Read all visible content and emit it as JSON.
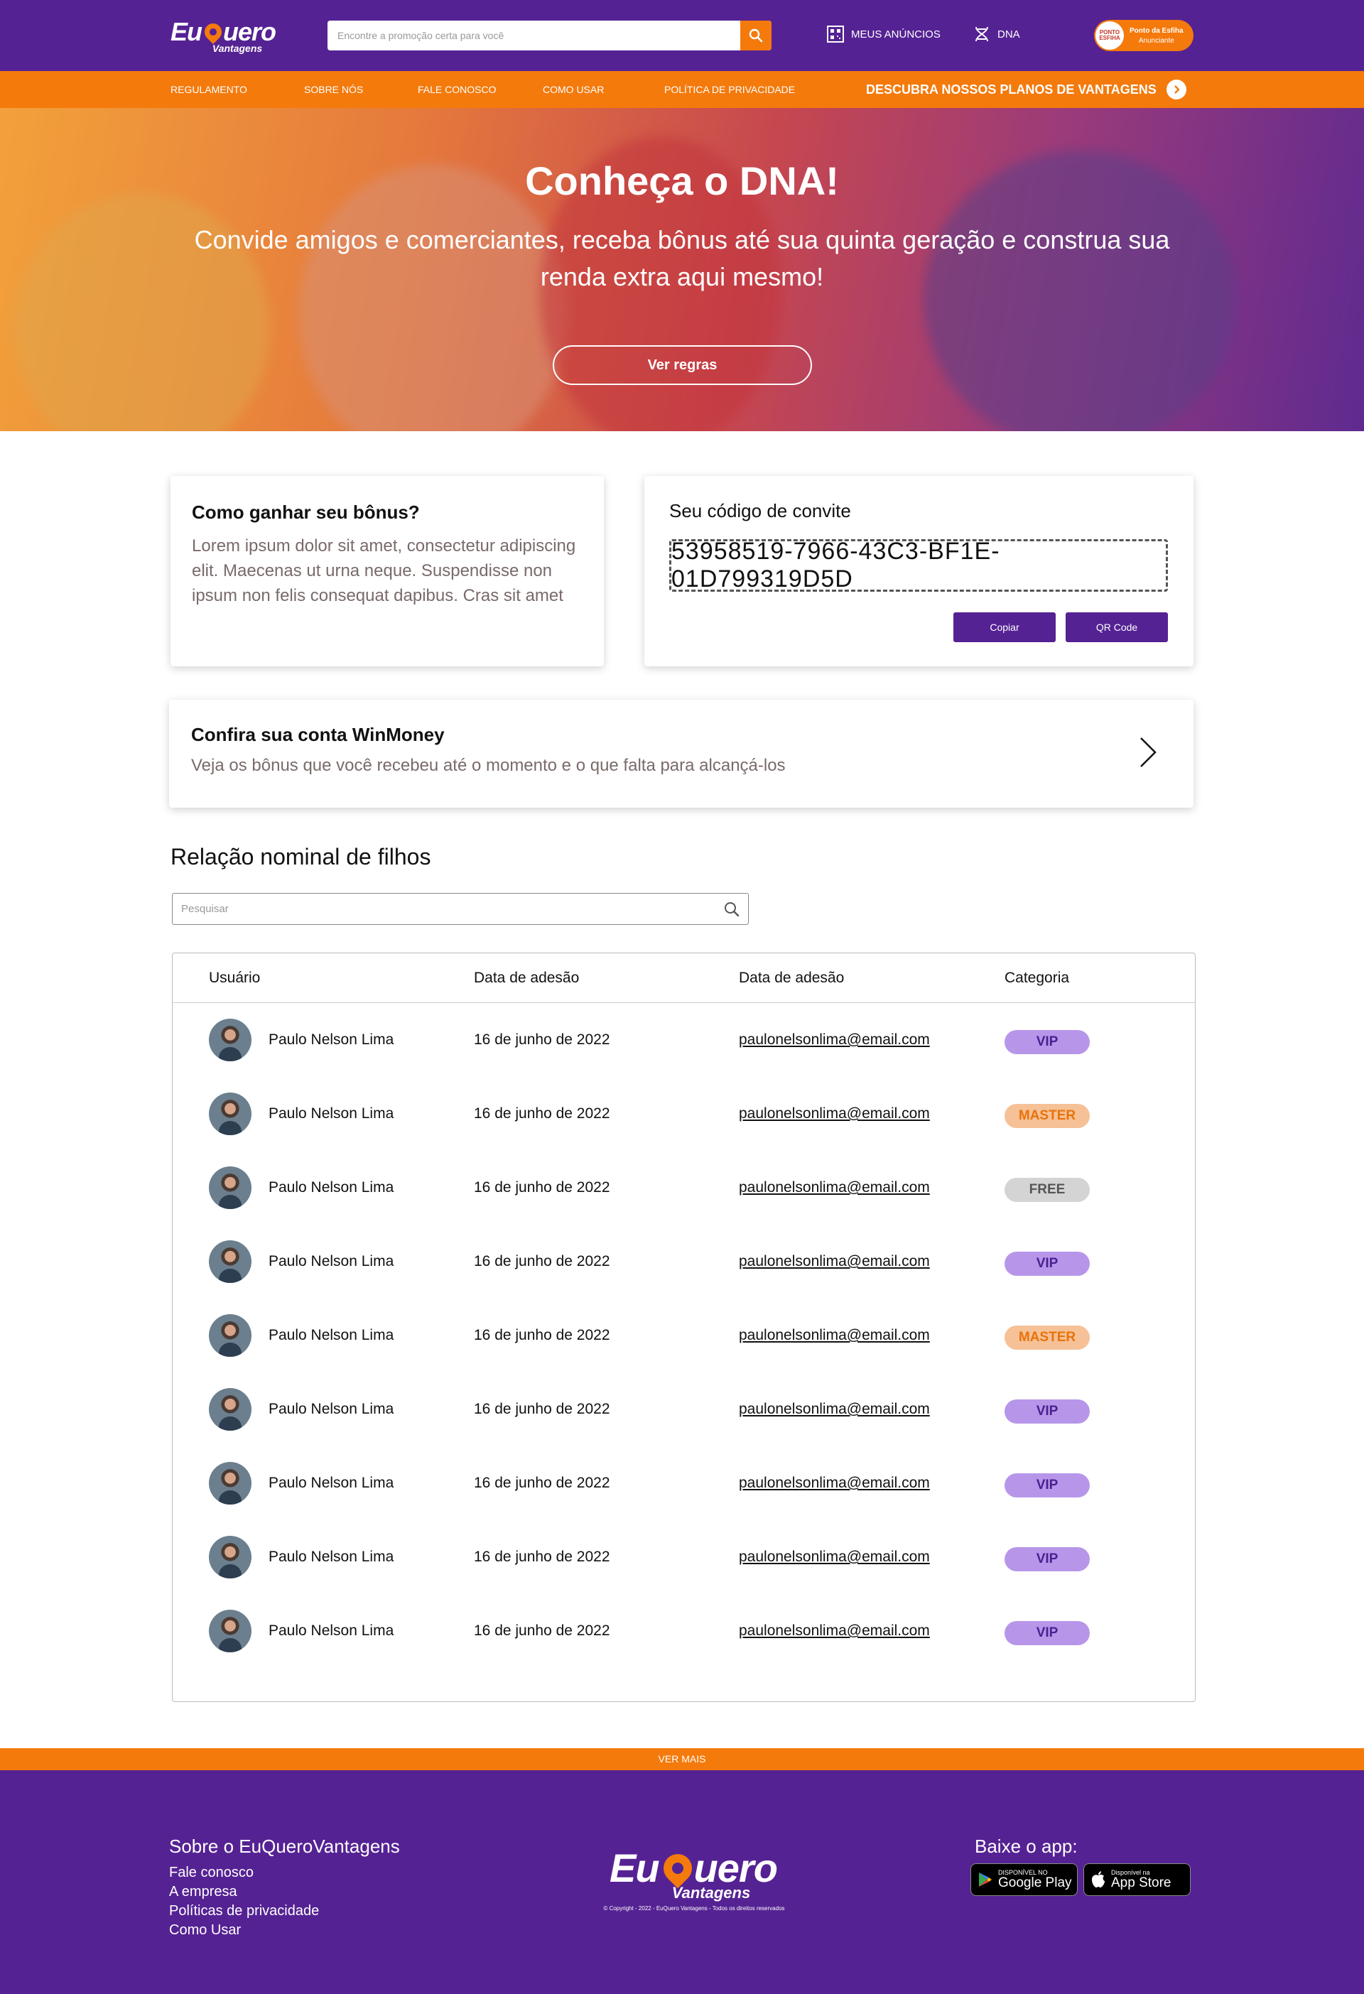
{
  "header": {
    "logo_main_left": "Eu",
    "logo_main_right": "uero",
    "logo_sub": "Vantagens",
    "search_placeholder": "Encontre a promoção certa para você",
    "meus_anuncios": "MEUS ANÚNCIOS",
    "dna": "DNA",
    "advertiser_avatar": "PONTO ESFIHA",
    "advertiser_name": "Ponto da Esfiha",
    "advertiser_role": "Anunciante"
  },
  "nav": {
    "items": [
      "REGULAMENTO",
      "SOBRE NÓS",
      "FALE CONOSCO",
      "COMO USAR",
      "POLÍTICA DE PRIVACIDADE"
    ],
    "plans": "DESCUBRA NOSSOS PLANOS DE VANTAGENS"
  },
  "hero": {
    "title": "Conheça o DNA!",
    "text": "Convide amigos e comerciantes, receba bônus até sua quinta geração e construa sua renda extra aqui mesmo!",
    "button": "Ver regras"
  },
  "bonus_card": {
    "title": "Como ganhar seu bônus?",
    "body": "Lorem ipsum dolor sit amet, consectetur adipiscing elit. Maecenas ut urna neque. Suspendisse non ipsum non felis consequat dapibus. Cras sit amet"
  },
  "invite_card": {
    "title": "Seu código de convite",
    "code": "53958519-7966-43C3-BF1E-01D799319D5D",
    "copy_button": "Copiar",
    "qr_button": "QR Code"
  },
  "winmoney_card": {
    "title": "Confira sua conta WinMoney",
    "body": "Veja os bônus que você recebeu até o momento e o que falta para alcançá-los"
  },
  "children": {
    "title": "Relação nominal de filhos",
    "search_placeholder": "Pesquisar",
    "columns": [
      "Usuário",
      "Data de adesão",
      "Data de adesão",
      "Categoria"
    ],
    "rows": [
      {
        "name": "Paulo Nelson Lima",
        "date": "16 de junho de 2022",
        "email": "paulonelsonlima@email.com",
        "category": "VIP"
      },
      {
        "name": "Paulo Nelson Lima",
        "date": "16 de junho de 2022",
        "email": "paulonelsonlima@email.com",
        "category": "MASTER"
      },
      {
        "name": "Paulo Nelson Lima",
        "date": "16 de junho de 2022",
        "email": "paulonelsonlima@email.com",
        "category": "FREE"
      },
      {
        "name": "Paulo Nelson Lima",
        "date": "16 de junho de 2022",
        "email": "paulonelsonlima@email.com",
        "category": "VIP"
      },
      {
        "name": "Paulo Nelson Lima",
        "date": "16 de junho de 2022",
        "email": "paulonelsonlima@email.com",
        "category": "MASTER"
      },
      {
        "name": "Paulo Nelson Lima",
        "date": "16 de junho de 2022",
        "email": "paulonelsonlima@email.com",
        "category": "VIP"
      },
      {
        "name": "Paulo Nelson Lima",
        "date": "16 de junho de 2022",
        "email": "paulonelsonlima@email.com",
        "category": "VIP"
      },
      {
        "name": "Paulo Nelson Lima",
        "date": "16 de junho de 2022",
        "email": "paulonelsonlima@email.com",
        "category": "VIP"
      },
      {
        "name": "Paulo Nelson Lima",
        "date": "16 de junho de 2022",
        "email": "paulonelsonlima@email.com",
        "category": "VIP"
      }
    ],
    "ver_mais": "VER MAIS"
  },
  "badge_styles": {
    "VIP": {
      "bg": "#b796ea",
      "fg": "#4b2090"
    },
    "MASTER": {
      "bg": "#f6c196",
      "fg": "#e8720c"
    },
    "FREE": {
      "bg": "#d4d4d4",
      "fg": "#555555"
    }
  },
  "footer": {
    "about_title": "Sobre o EuQueroVantagens",
    "links": [
      "Fale conosco",
      "A empresa",
      "Políticas de privacidade",
      "Como Usar"
    ],
    "copyright": "© Copyright - 2022 - EuQuero Vantagens - Todos os direitos reservados",
    "app_title": "Baixe o app:",
    "google_small": "DISPONÍVEL NO",
    "google_big": "Google Play",
    "apple_small": "Disponível na",
    "apple_big": "App Store"
  },
  "colors": {
    "purple": "#552293",
    "orange": "#f47a0c"
  },
  "icons": [
    "search-icon",
    "qr-grid-icon",
    "dna-icon",
    "chevron-right-icon",
    "google-play-icon",
    "apple-icon"
  ]
}
